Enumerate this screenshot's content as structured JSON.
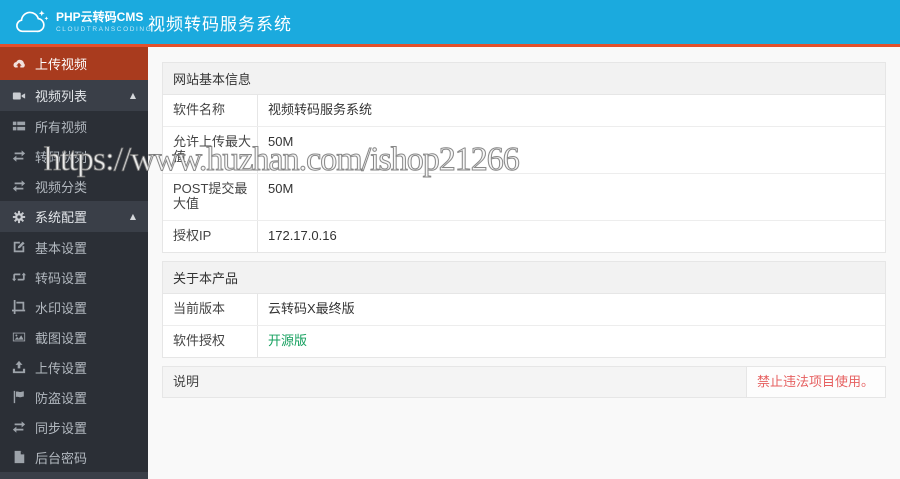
{
  "header": {
    "logo_title": "PHP云转码CMS",
    "logo_subtitle": "CLOUDTRANSCODING",
    "page_title": "视频转码服务系统"
  },
  "sidebar": {
    "arrow_glyph": "▲",
    "items": [
      {
        "label": "上传视频",
        "icon": "cloud-upload-icon",
        "active": true
      },
      {
        "label": "视频列表",
        "icon": "video-camera-icon",
        "expanded": true
      },
      {
        "label": "所有视频",
        "icon": "list-icon"
      },
      {
        "label": "转码队列",
        "icon": "exchange-icon"
      },
      {
        "label": "视频分类",
        "icon": "exchange-icon"
      },
      {
        "label": "系统配置",
        "icon": "gear-icon",
        "expanded": true
      },
      {
        "label": "基本设置",
        "icon": "edit-icon"
      },
      {
        "label": "转码设置",
        "icon": "retweet-icon"
      },
      {
        "label": "水印设置",
        "icon": "crop-icon"
      },
      {
        "label": "截图设置",
        "icon": "image-icon"
      },
      {
        "label": "上传设置",
        "icon": "upload-icon"
      },
      {
        "label": "防盗设置",
        "icon": "flag-icon"
      },
      {
        "label": "同步设置",
        "icon": "exchange-icon"
      },
      {
        "label": "后台密码",
        "icon": "file-icon"
      }
    ]
  },
  "panels": [
    {
      "title": "网站基本信息",
      "rows": [
        {
          "label": "软件名称",
          "value": "视频转码服务系统"
        },
        {
          "label": "允许上传最大值",
          "value": "50M"
        },
        {
          "label": "POST提交最大值",
          "value": "50M"
        },
        {
          "label": "授权IP",
          "value": "172.17.0.16"
        }
      ]
    },
    {
      "title": "关于本产品",
      "rows": [
        {
          "label": "当前版本",
          "value": "云转码X最终版"
        },
        {
          "label": "软件授权",
          "value": "开源版"
        }
      ]
    }
  ],
  "note": {
    "label": "说明",
    "value": "禁止违法项目使用。"
  },
  "watermark": "https://www.huzhan.com/ishop21266",
  "colors": {
    "topbar_bg": "#1baade",
    "accent_line": "#e2502c",
    "sidebar_bg": "#3a3f48",
    "sidebar_submenu_bg": "#2b2f36",
    "active_item_bg": "#a93b1e",
    "link_green": "#16a05f",
    "note_red": "#e66060"
  }
}
